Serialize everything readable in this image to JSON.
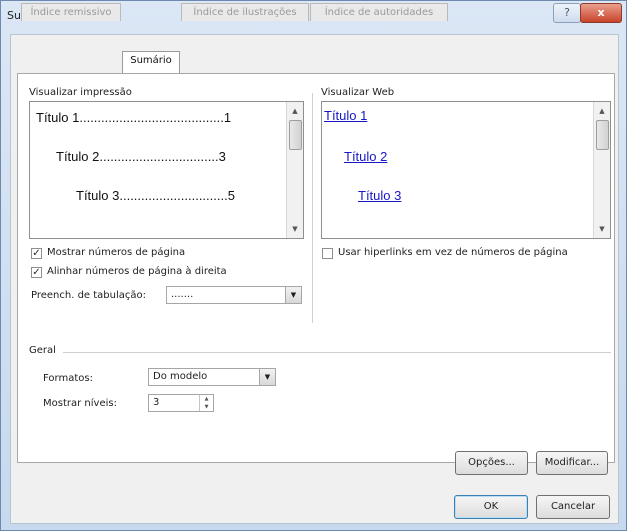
{
  "window": {
    "title": "Sumário",
    "help_glyph": "?",
    "close_glyph": "x"
  },
  "tabs": [
    {
      "label": "Índice remissivo",
      "active": false
    },
    {
      "label": "Sumário",
      "active": true
    },
    {
      "label": "Índice de ilustrações",
      "active": false
    },
    {
      "label": "Índice de autoridades",
      "active": false
    }
  ],
  "print_preview": {
    "label": "Visualizar impressão",
    "entries": [
      {
        "text": "Título 1",
        "leader": "........................................",
        "page": "1"
      },
      {
        "text": "Título 2",
        "leader": ".................................",
        "page": "3"
      },
      {
        "text": "Título 3",
        "leader": "..............................",
        "page": "5"
      }
    ]
  },
  "web_preview": {
    "label": "Visualizar Web",
    "links": [
      "Título 1",
      "Título 2",
      "Título 3"
    ]
  },
  "options": {
    "show_page_numbers": {
      "label": "Mostrar números de página",
      "checked": true
    },
    "right_align_page_numbers": {
      "label": "Alinhar números de página à direita",
      "checked": true
    },
    "use_hyperlinks": {
      "label": "Usar hiperlinks em vez de números de página",
      "checked": false
    },
    "tab_leader": {
      "label": "Preench. de tabulação:",
      "value": "......."
    }
  },
  "general": {
    "label": "Geral",
    "formats": {
      "label": "Formatos:",
      "value": "Do modelo"
    },
    "show_levels": {
      "label": "Mostrar níveis:",
      "value": "3"
    }
  },
  "buttons": {
    "options": "Opções...",
    "modify": "Modificar...",
    "ok": "OK",
    "cancel": "Cancelar"
  }
}
